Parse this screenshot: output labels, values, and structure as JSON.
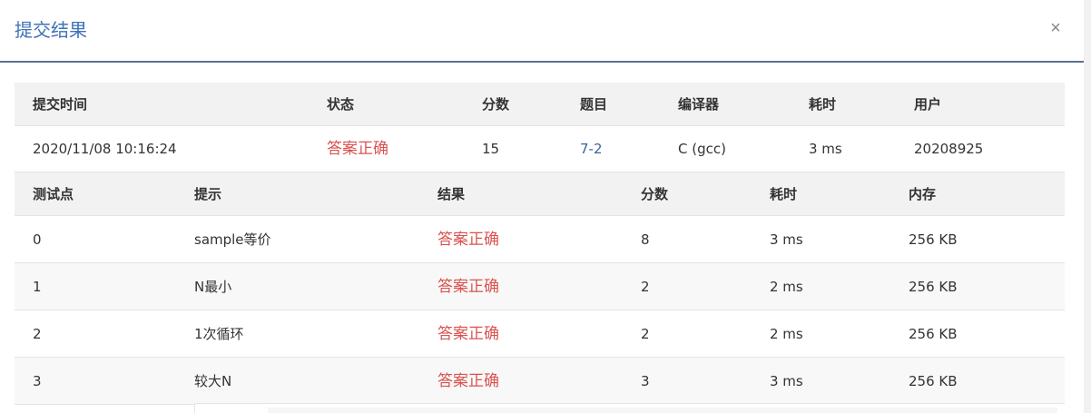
{
  "modal": {
    "title": "提交结果",
    "close_glyph": "×",
    "close_icon": "close-icon"
  },
  "summary": {
    "headers": [
      "提交时间",
      "状态",
      "分数",
      "题目",
      "编译器",
      "耗时",
      "用户"
    ],
    "row": {
      "time": "2020/11/08 10:16:24",
      "status": "答案正确",
      "score": "15",
      "problem": "7-2",
      "compiler": "C (gcc)",
      "duration": "3 ms",
      "user": "20208925"
    }
  },
  "cases": {
    "headers": [
      "测试点",
      "提示",
      "结果",
      "分数",
      "耗时",
      "内存"
    ],
    "rows": [
      {
        "id": "0",
        "hint": "sample等价",
        "result": "答案正确",
        "score": "8",
        "time": "3 ms",
        "memory": "256 KB"
      },
      {
        "id": "1",
        "hint": "N最小",
        "result": "答案正确",
        "score": "2",
        "time": "2 ms",
        "memory": "256 KB"
      },
      {
        "id": "2",
        "hint": "1次循环",
        "result": "答案正确",
        "score": "2",
        "time": "2 ms",
        "memory": "256 KB"
      },
      {
        "id": "3",
        "hint": "较大N",
        "result": "答案正确",
        "score": "3",
        "time": "3 ms",
        "memory": "256 KB"
      }
    ]
  },
  "colors": {
    "title": "#3f73b8",
    "accepted": "#d9534f",
    "link": "#3a6598",
    "header_bg": "#f2f2f2"
  }
}
